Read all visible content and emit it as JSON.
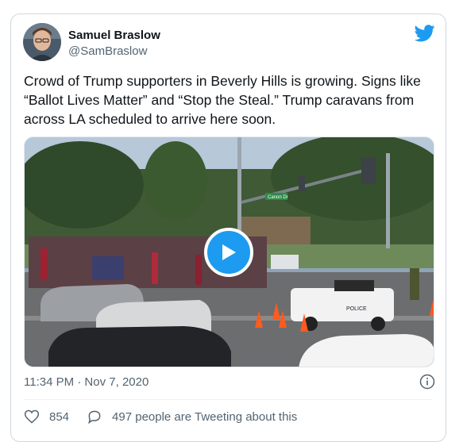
{
  "author": {
    "name": "Samuel Braslow",
    "handle": "@SamBraslow"
  },
  "tweet": {
    "text": "Crowd of Trump supporters in Beverly Hills is growing. Signs like “Ballot Lives Matter” and “Stop the Steal.” Trump caravans from across LA scheduled to arrive here soon.",
    "timestamp": "11:34 PM · Nov 7, 2020"
  },
  "media": {
    "type": "video",
    "street_sign": "Canon Dr",
    "police_text": "POLICE"
  },
  "actions": {
    "likes": "854",
    "conversation": "497 people are Tweeting about this"
  },
  "colors": {
    "accent": "#1d9bf0",
    "like": "#536471"
  },
  "icons": [
    "twitter-bird-icon",
    "play-icon",
    "info-icon",
    "heart-icon",
    "comment-icon"
  ]
}
